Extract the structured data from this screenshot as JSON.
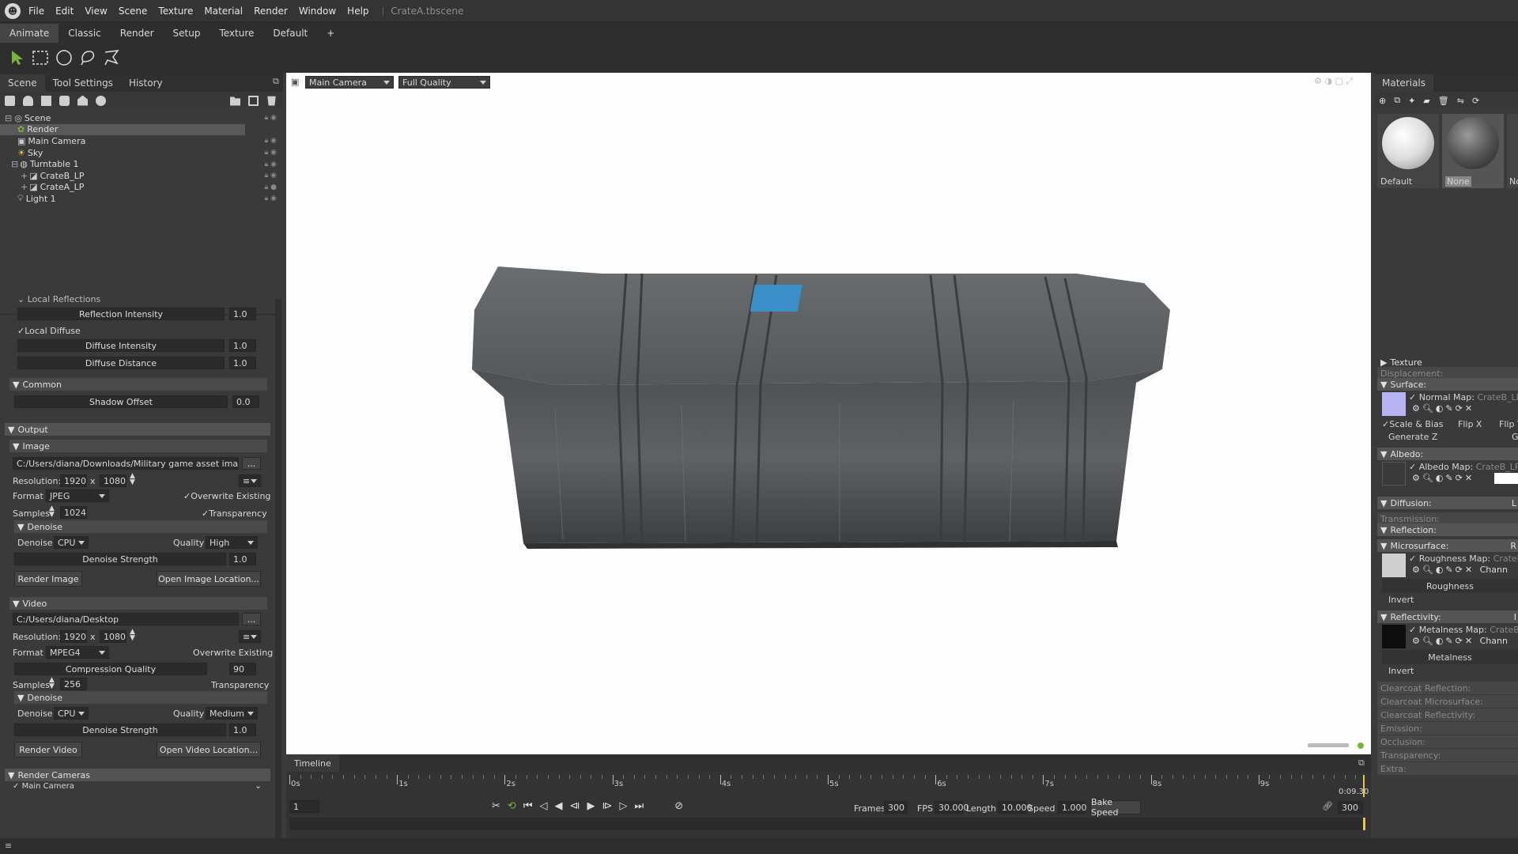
{
  "app": {
    "document": "CrateA.tbscene"
  },
  "menu": [
    "File",
    "Edit",
    "View",
    "Scene",
    "Texture",
    "Material",
    "Render",
    "Window",
    "Help"
  ],
  "workspace_tabs": [
    "Animate",
    "Classic",
    "Render",
    "Setup",
    "Texture",
    "Default",
    "+"
  ],
  "left_panel": {
    "tabs": [
      "Scene",
      "Tool Settings",
      "History"
    ],
    "tree": [
      {
        "label": "Scene",
        "depth": 0
      },
      {
        "label": "Render",
        "depth": 1,
        "selected": true
      },
      {
        "label": "Main Camera",
        "depth": 1
      },
      {
        "label": "Sky",
        "depth": 1
      },
      {
        "label": "Turntable 1",
        "depth": 1
      },
      {
        "label": "CrateB_LP",
        "depth": 2
      },
      {
        "label": "CrateA_LP",
        "depth": 2
      },
      {
        "label": "Light 1",
        "depth": 1
      }
    ],
    "local_reflections": {
      "header": "Local Reflections",
      "intensity_label": "Reflection Intensity",
      "intensity_value": "1.0"
    },
    "local_diffuse": {
      "label": "Local Diffuse",
      "intensity_label": "Diffuse Intensity",
      "intensity_value": "1.0",
      "distance_label": "Diffuse Distance",
      "distance_value": "1.0"
    },
    "common": {
      "header": "Common",
      "shadow_label": "Shadow Offset",
      "shadow_value": "0.0"
    },
    "output": {
      "header": "Output",
      "image": {
        "header": "Image",
        "path": "C:/Users/diana/Downloads/Military game asset images/Re",
        "browse": "...",
        "res_label": "Resolution:",
        "res_w": "1920",
        "res_x": "x",
        "res_h": "1080",
        "format_label": "Format",
        "format": "JPEG",
        "overwrite": "Overwrite Existing",
        "samples_label": "Samples",
        "samples": "1024",
        "transparency": "Transparency",
        "denoise_header": "Denoise",
        "denoise_label": "Denoise",
        "denoise": "CPU",
        "quality_label": "Quality",
        "quality": "High",
        "strength_label": "Denoise Strength",
        "strength": "1.0",
        "render_btn": "Render Image",
        "open_btn": "Open Image Location..."
      },
      "video": {
        "header": "Video",
        "path": "C:/Users/diana/Desktop",
        "browse": "...",
        "res_label": "Resolution:",
        "res_w": "1920",
        "res_x": "x",
        "res_h": "1080",
        "format_label": "Format",
        "format": "MPEG4",
        "overwrite": "Overwrite Existing",
        "compression_label": "Compression Quality",
        "compression": "90",
        "samples_label": "Samples",
        "samples": "256",
        "transparency": "Transparency",
        "denoise_header": "Denoise",
        "denoise_label": "Denoise",
        "denoise": "CPU",
        "quality_label": "Quality",
        "quality": "Medium",
        "strength_label": "Denoise Strength",
        "strength": "1.0",
        "render_btn": "Render Video",
        "open_btn": "Open Video Location..."
      },
      "cameras": {
        "header": "Render Cameras",
        "item": "Main Camera"
      }
    }
  },
  "viewport": {
    "camera": "Main Camera",
    "quality": "Full Quality"
  },
  "timeline": {
    "title": "Timeline",
    "ticks": [
      "0s",
      "1s",
      "2s",
      "3s",
      "4s",
      "5s",
      "6s",
      "7s",
      "8s",
      "9s"
    ],
    "time": "0:09.30",
    "frame": "1",
    "frames_label": "Frames",
    "frames": "300",
    "fps_label": "FPS",
    "fps": "30.000",
    "length_label": "Length",
    "length": "10.000",
    "speed_label": "Speed",
    "speed": "1.000",
    "bake": "Bake Speed",
    "end": "300"
  },
  "materials": {
    "title": "Materials",
    "thumbs": [
      "Default",
      "None",
      "No"
    ],
    "rows": {
      "texture": "Texture",
      "displacement": "Displacement:",
      "surface": "Surface:",
      "normal_map": "Normal Map:",
      "normal_file": "CrateB_LP_Cr",
      "scale_bias": "Scale & Bias",
      "flipx": "Flip X",
      "flipy": "Flip Y",
      "genz": "Generate Z",
      "genz_r": "G",
      "albedo": "Albedo:",
      "albedo_map": "Albedo Map:",
      "albedo_file": "CrateB_LP_Cr",
      "diffusion": "Diffusion:",
      "diffusion_r": "L",
      "transmission": "Transmission:",
      "reflection": "Reflection:",
      "microsurface": "Microsurface:",
      "microsurface_r": "R",
      "rough_map": "Roughness Map:",
      "rough_file": "CrateB_L",
      "channel": "Chann",
      "roughness": "Roughness",
      "invert": "Invert",
      "reflectivity": "Reflectivity:",
      "reflectivity_r": "I",
      "metal_map": "Metalness Map:",
      "metal_file": "CrateB_LP",
      "channel2": "Chann",
      "metalness": "Metalness",
      "invert2": "Invert",
      "cc_refl": "Clearcoat Reflection:",
      "cc_micro": "Clearcoat Microsurface:",
      "cc_reflect": "Clearcoat Reflectivity:",
      "emission": "Emission:",
      "occlusion": "Occlusion:",
      "transparency": "Transparency:",
      "extra": "Extra:"
    }
  },
  "colors": {
    "accent": "#7ab53a",
    "crate_logo": "#3a8fc9"
  }
}
